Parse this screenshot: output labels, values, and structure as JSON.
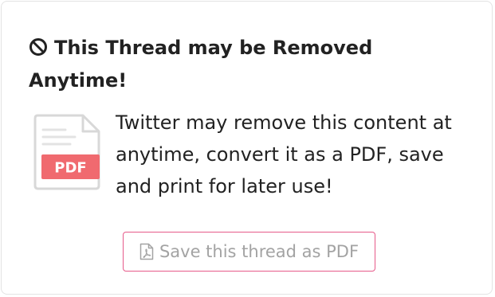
{
  "card": {
    "title": "This Thread may be Removed Anytime!",
    "message": "Twitter may remove this content at anytime, convert it as a PDF, save and print for later use!",
    "pdf_badge_label": "PDF",
    "save_button_label": "Save this thread as PDF",
    "icons": {
      "title": "ban-icon",
      "illustration": "pdf-document-icon",
      "button": "file-pdf-icon"
    },
    "colors": {
      "accent": "#e65a8a",
      "pdf_badge": "#f06a6f",
      "document_outline": "#d8d8d8",
      "button_text": "#a3a3a3"
    }
  }
}
